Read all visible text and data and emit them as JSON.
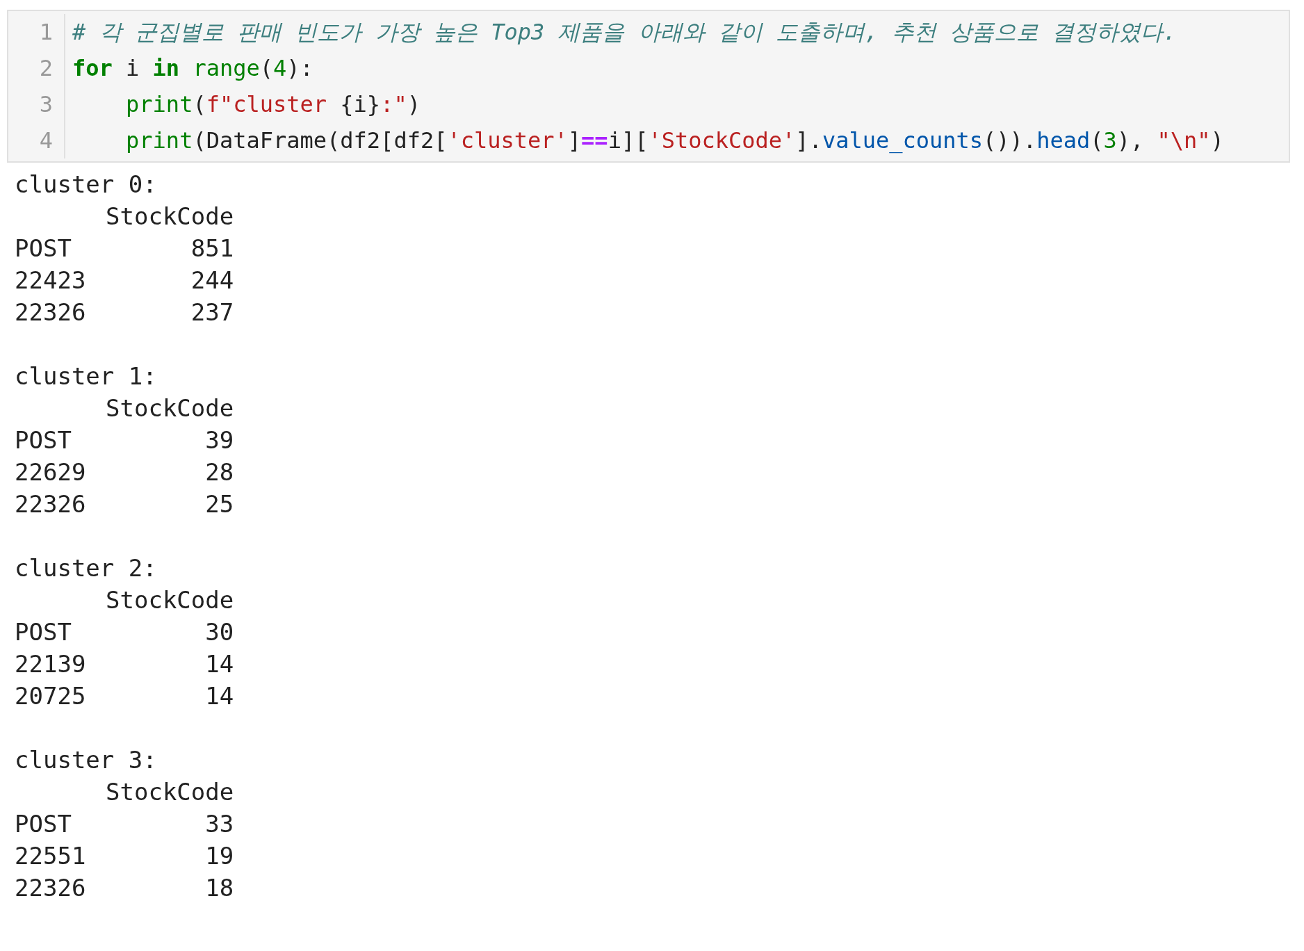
{
  "code_cell": {
    "lines": [
      {
        "number": "1",
        "indented": false,
        "tokens": [
          {
            "kind": "comment",
            "text": "# 각 군집별로 판매 빈도가 가장 높은 Top3 제품을 아래와 같이 도출하며, 추천 상품으로 결정하였다."
          }
        ]
      },
      {
        "number": "2",
        "indented": false,
        "tokens": [
          {
            "kind": "keyword",
            "text": "for"
          },
          {
            "kind": "plain",
            "text": " i "
          },
          {
            "kind": "keyword",
            "text": "in"
          },
          {
            "kind": "builtin",
            "text": " range"
          },
          {
            "kind": "plain",
            "text": "("
          },
          {
            "kind": "number",
            "text": "4"
          },
          {
            "kind": "plain",
            "text": "):"
          }
        ]
      },
      {
        "number": "3",
        "indented": true,
        "tokens": [
          {
            "kind": "builtin",
            "text": "print"
          },
          {
            "kind": "plain",
            "text": "("
          },
          {
            "kind": "string",
            "text": "f\"cluster "
          },
          {
            "kind": "plain",
            "text": "{i}"
          },
          {
            "kind": "string",
            "text": ":\""
          },
          {
            "kind": "plain",
            "text": ")"
          }
        ]
      },
      {
        "number": "4",
        "indented": true,
        "tokens": [
          {
            "kind": "builtin",
            "text": "print"
          },
          {
            "kind": "plain",
            "text": "(DataFrame(df2[df2["
          },
          {
            "kind": "string",
            "text": "'cluster'"
          },
          {
            "kind": "plain",
            "text": "]"
          },
          {
            "kind": "operator",
            "text": "=="
          },
          {
            "kind": "plain",
            "text": "i]["
          },
          {
            "kind": "string",
            "text": "'StockCode'"
          },
          {
            "kind": "plain",
            "text": "]."
          },
          {
            "kind": "method",
            "text": "value_counts"
          },
          {
            "kind": "plain",
            "text": "())."
          },
          {
            "kind": "method",
            "text": "head"
          },
          {
            "kind": "plain",
            "text": "("
          },
          {
            "kind": "number",
            "text": "3"
          },
          {
            "kind": "plain",
            "text": "), "
          },
          {
            "kind": "string",
            "text": "\"\\n\""
          },
          {
            "kind": "plain",
            "text": ")"
          }
        ]
      }
    ]
  },
  "output": [
    {
      "title": "cluster 0:",
      "column": "StockCode",
      "rows": [
        {
          "index": "POST",
          "value": "851"
        },
        {
          "index": "22423",
          "value": "244"
        },
        {
          "index": "22326",
          "value": "237"
        }
      ]
    },
    {
      "title": "cluster 1:",
      "column": "StockCode",
      "rows": [
        {
          "index": "POST",
          "value": "39"
        },
        {
          "index": "22629",
          "value": "28"
        },
        {
          "index": "22326",
          "value": "25"
        }
      ]
    },
    {
      "title": "cluster 2:",
      "column": "StockCode",
      "rows": [
        {
          "index": "POST",
          "value": "30"
        },
        {
          "index": "22139",
          "value": "14"
        },
        {
          "index": "20725",
          "value": "14"
        }
      ]
    },
    {
      "title": "cluster 3:",
      "column": "StockCode",
      "rows": [
        {
          "index": "POST",
          "value": "33"
        },
        {
          "index": "22551",
          "value": "19"
        },
        {
          "index": "22326",
          "value": "18"
        }
      ]
    }
  ]
}
